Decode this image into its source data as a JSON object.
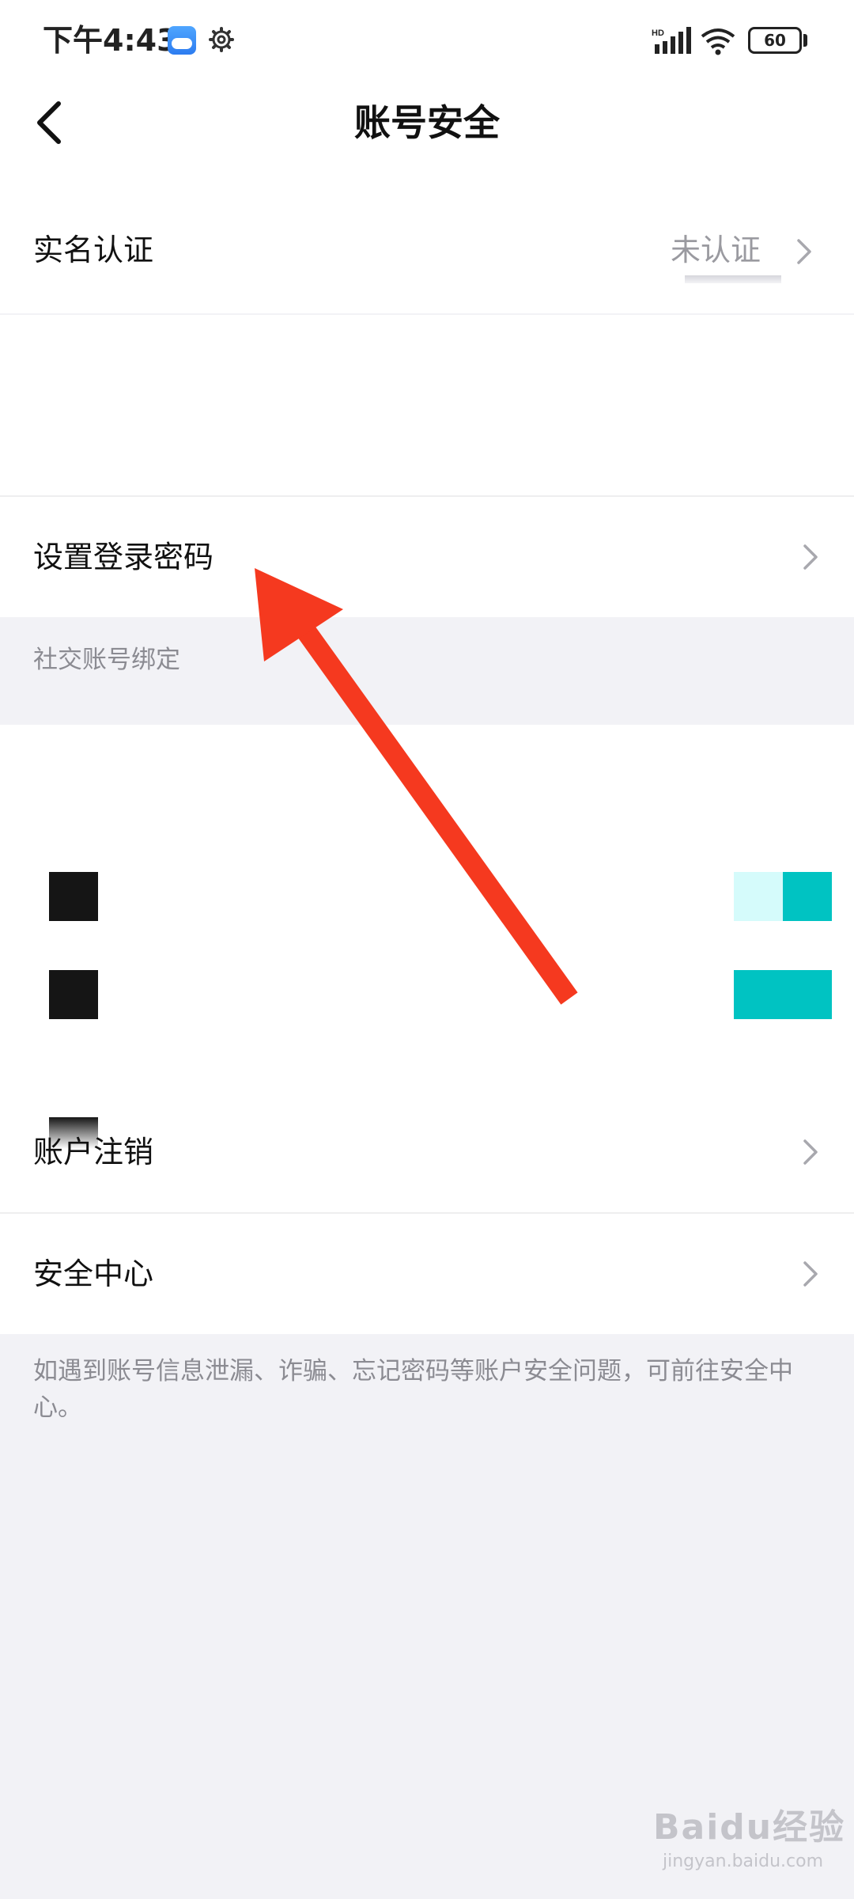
{
  "status_bar": {
    "time": "下午4:43",
    "network_badge": "HD",
    "battery": "60",
    "icons": [
      "weather-icon",
      "gear-icon",
      "signal-icon",
      "wifi-icon",
      "battery-icon"
    ]
  },
  "header": {
    "title": "账号安全",
    "back_icon": "chevron-left-icon"
  },
  "rows": {
    "real_name": {
      "label": "实名认证",
      "value": "未认证"
    },
    "set_password": {
      "label": "设置登录密码"
    },
    "social_binding_caption": "社交账号绑定",
    "deactivate": {
      "label": "账户注销"
    },
    "security_center": {
      "label": "安全中心"
    }
  },
  "footer": {
    "note": "如遇到账号信息泄漏、诈骗、忘记密码等账户安全问题，可前往安全中心。"
  },
  "colors": {
    "page_background": "#f2f2f6",
    "row_background": "#ffffff",
    "secondary_text": "#8b8b92",
    "accent_teal": "#00c3c2",
    "annotation_arrow": "#f5391f"
  },
  "watermark": {
    "logo_text": "Baidu经验",
    "url": "jingyan.baidu.com"
  }
}
